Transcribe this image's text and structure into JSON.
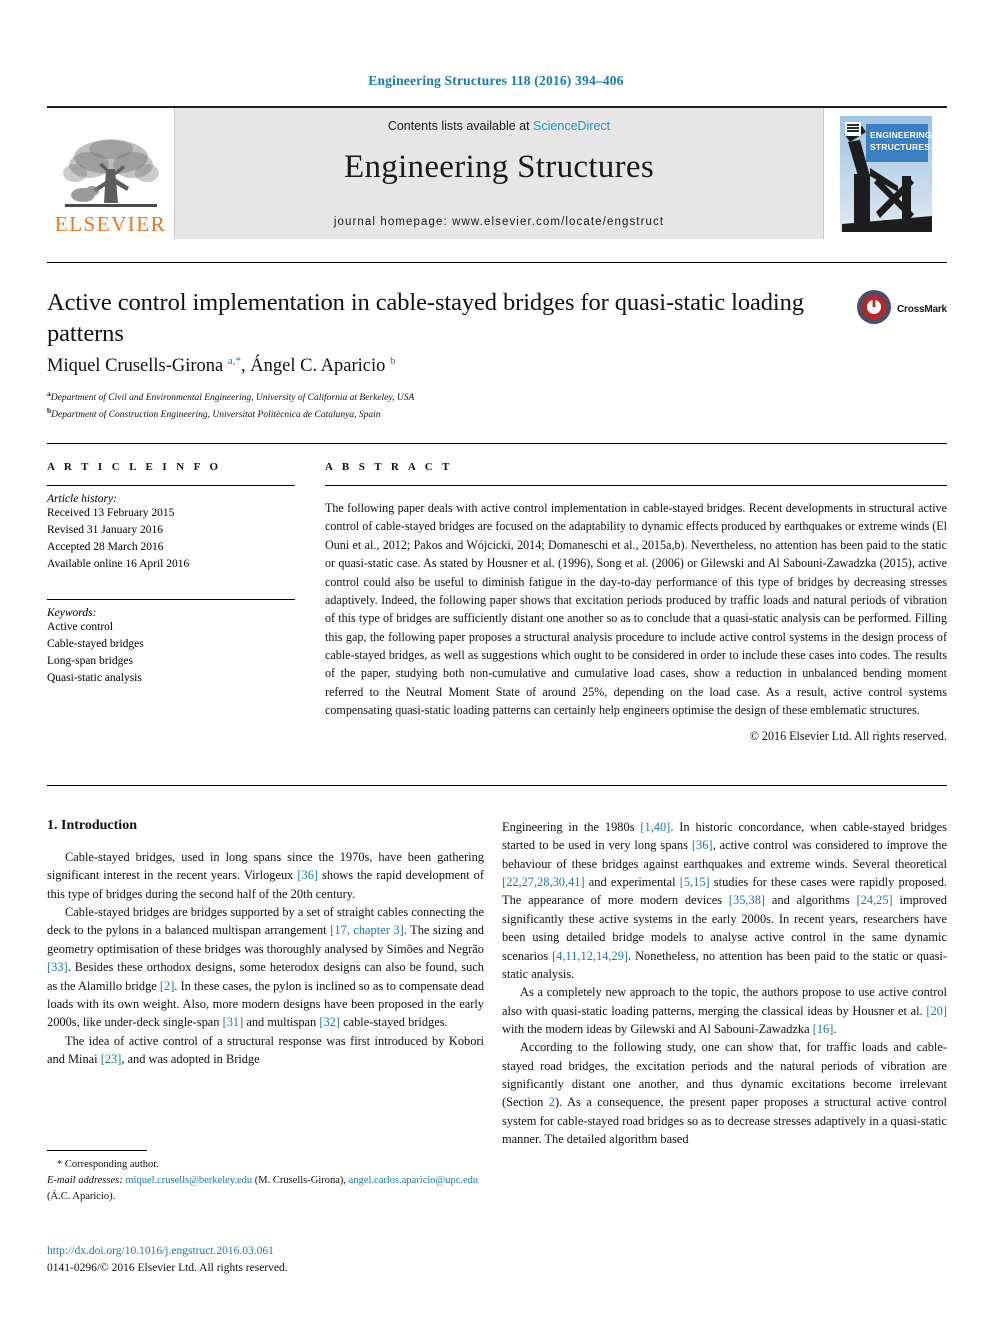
{
  "running_head": "Engineering Structures 118 (2016) 394–406",
  "banner": {
    "publisher_name": "ELSEVIER",
    "publisher_logo_icon": "elsevier-tree-icon",
    "contents_prefix": "Contents lists available at ",
    "contents_link": "ScienceDirect",
    "journal_title": "Engineering Structures",
    "homepage": "journal homepage: www.elsevier.com/locate/engstruct",
    "cover_title_line1": "ENGINEERING",
    "cover_title_line2": "STRUCTURES",
    "cover_icon": "journal-cover-thumbnail"
  },
  "article": {
    "title": "Active control implementation in cable-stayed bridges for quasi-static loading patterns",
    "crossmark_label": "CrossMark",
    "crossmark_icon": "crossmark-badge-icon",
    "authors_html": "Miquel Crusells-Girona <sup class=\"sup\">a,*</sup>, Ángel C. Aparicio <sup class=\"sup\">b</sup>",
    "affiliation_a_marker": "a",
    "affiliation_a": "Department of Civil and Environmental Engineering, University of California at Berkeley, USA",
    "affiliation_b_marker": "b",
    "affiliation_b": "Department of Construction Engineering, Universitat Politècnica de Catalunya, Spain"
  },
  "article_info": {
    "heading": "A R T I C L E   I N F O",
    "history_label": "Article history:",
    "history": [
      "Received 13 February 2015",
      "Revised 31 January 2016",
      "Accepted 28 March 2016",
      "Available online 16 April 2016"
    ],
    "keywords_label": "Keywords:",
    "keywords": [
      "Active control",
      "Cable-stayed bridges",
      "Long-span bridges",
      "Quasi-static analysis"
    ]
  },
  "abstract": {
    "heading": "A B S T R A C T",
    "text": "The following paper deals with active control implementation in cable-stayed bridges. Recent developments in structural active control of cable-stayed bridges are focused on the adaptability to dynamic effects produced by earthquakes or extreme winds (El Ouni et al., 2012; Pakos and Wójcicki, 2014; Domaneschi et al., 2015a,b). Nevertheless, no attention has been paid to the static or quasi-static case. As stated by Housner et al. (1996), Song et al. (2006) or Gilewski and Al Sabouni-Zawadzka (2015), active control could also be useful to diminish fatigue in the day-to-day performance of this type of bridges by decreasing stresses adaptively. Indeed, the following paper shows that excitation periods produced by traffic loads and natural periods of vibration of this type of bridges are sufficiently distant one another so as to conclude that a quasi-static analysis can be performed. Filling this gap, the following paper proposes a structural analysis procedure to include active control systems in the design process of cable-stayed bridges, as well as suggestions which ought to be considered in order to include these cases into codes. The results of the paper, studying both non-cumulative and cumulative load cases, show a reduction in unbalanced bending moment referred to the Neutral Moment State of around 25%, depending on the load case. As a result, active control systems compensating quasi-static loading patterns can certainly help engineers optimise the design of these emblematic structures.",
    "copyright": "© 2016 Elsevier Ltd. All rights reserved."
  },
  "body": {
    "section_heading": "1. Introduction",
    "left_paragraphs": [
      "Cable-stayed bridges, used in long spans since the 1970s, have been gathering significant interest in the recent years. Virlogeux <span class=\"ref\">[36]</span> shows the rapid development of this type of bridges during the second half of the 20th century.",
      "Cable-stayed bridges are bridges supported by a set of straight cables connecting the deck to the pylons in a balanced multispan arrangement <span class=\"ref\">[17, chapter 3]</span>. The sizing and geometry optimisation of these bridges was thoroughly analysed by Simões and Negrão <span class=\"ref\">[33]</span>. Besides these orthodox designs, some heterodox designs can also be found, such as the Alamillo bridge <span class=\"ref\">[2]</span>. In these cases, the pylon is inclined so as to compensate dead loads with its own weight. Also, more modern designs have been proposed in the early 2000s, like under-deck single-span <span class=\"ref\">[31]</span> and multispan <span class=\"ref\">[32]</span> cable-stayed bridges.",
      "The idea of active control of a structural response was first introduced by Kobori and Minai <span class=\"ref\">[23]</span>, and was adopted in Bridge"
    ],
    "right_paragraphs": [
      "Engineering in the 1980s <span class=\"ref\">[1,40]</span>. In historic concordance, when cable-stayed bridges started to be used in very long spans <span class=\"ref\">[36]</span>, active control was considered to improve the behaviour of these bridges against earthquakes and extreme winds. Several theoretical <span class=\"ref\">[22,27,28,30,41]</span> and experimental <span class=\"ref\">[5,15]</span> studies for these cases were rapidly proposed. The appearance of more modern devices <span class=\"ref\">[35,38]</span> and algorithms <span class=\"ref\">[24,25]</span> improved significantly these active systems in the early 2000s. In recent years, researchers have been using detailed bridge models to analyse active control in the same dynamic scenarios <span class=\"ref\">[4,11,12,14,29]</span>. Nonetheless, no attention has been paid to the static or quasi-static analysis.",
      "As a completely new approach to the topic, the authors propose to use active control also with quasi-static loading patterns, merging the classical ideas by Housner et al. <span class=\"ref\">[20]</span> with the modern ideas by Gilewski and Al Sabouni-Zawadzka <span class=\"ref\">[16]</span>.",
      "According to the following study, one can show that, for traffic loads and cable-stayed road bridges, the excitation periods and the natural periods of vibration are significantly distant one another, and thus dynamic excitations become irrelevant (Section <span class=\"ref\">2</span>). As a consequence, the present paper proposes a structural active control system for cable-stayed road bridges so as to decrease stresses adaptively in a quasi-static manner. The detailed algorithm based"
    ]
  },
  "footnotes": {
    "corresponding": "* Corresponding author.",
    "email_label": "E-mail addresses:",
    "email_1": "miquel.crusells@berkeley.edu",
    "email_1_owner": "(M. Crusells-Girona),",
    "email_2": "angel.carlos.aparicio@upc.edu",
    "email_2_owner": "(Á.C. Aparicio)."
  },
  "imprint": {
    "doi_url": "http://dx.doi.org/10.1016/j.engstruct.2016.03.061",
    "issn_line": "0141-0296/© 2016 Elsevier Ltd. All rights reserved."
  },
  "colors": {
    "link_blue": "#1a7aa8",
    "sciencedirect_blue": "#2196c4",
    "elsevier_orange": "#e87722",
    "banner_grey": "#e6e6e6",
    "cover_blue": "#3a7fc1"
  }
}
